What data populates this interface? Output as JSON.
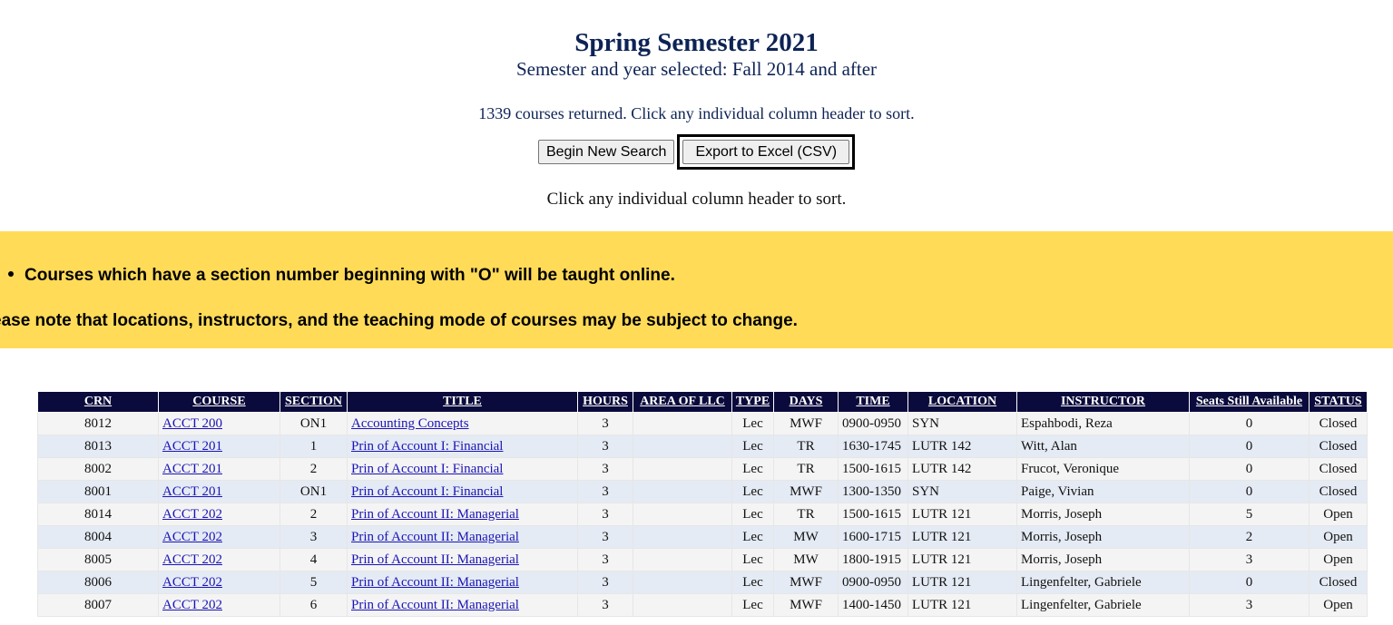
{
  "header": {
    "title": "Spring Semester 2021",
    "subtitle": "Semester and year selected: Fall 2014 and after",
    "courses_returned": "1339 courses returned. Click any individual column header to sort.",
    "sort_hint": "Click any individual column header to sort."
  },
  "buttons": {
    "new_search": "Begin New Search",
    "export": "Export to Excel (CSV)"
  },
  "notice": {
    "online": "Courses which have a section number beginning with \"O\" will be taught online.",
    "change": "ease note that locations, instructors, and the teaching mode of courses may be subject to change."
  },
  "table": {
    "headers": [
      "CRN",
      "COURSE",
      "SECTION",
      "TITLE",
      "HOURS",
      "AREA OF LLC",
      "TYPE",
      "DAYS",
      "TIME",
      "LOCATION",
      "INSTRUCTOR",
      "Seats Still Available",
      "STATUS"
    ],
    "rows": [
      {
        "crn": "8012",
        "course": "ACCT 200",
        "section": "ON1",
        "title": "Accounting Concepts",
        "hours": "3",
        "llc": "",
        "type": "Lec",
        "days": "MWF",
        "time": "0900-0950",
        "location": "SYN",
        "instructor": "Espahbodi, Reza",
        "seats": "0",
        "status": "Closed"
      },
      {
        "crn": "8013",
        "course": "ACCT 201",
        "section": "1",
        "title": "Prin of Account I: Financial",
        "hours": "3",
        "llc": "",
        "type": "Lec",
        "days": "TR",
        "time": "1630-1745",
        "location": "LUTR 142",
        "instructor": "Witt, Alan",
        "seats": "0",
        "status": "Closed"
      },
      {
        "crn": "8002",
        "course": "ACCT 201",
        "section": "2",
        "title": "Prin of Account I: Financial",
        "hours": "3",
        "llc": "",
        "type": "Lec",
        "days": "TR",
        "time": "1500-1615",
        "location": "LUTR 142",
        "instructor": "Frucot, Veronique",
        "seats": "0",
        "status": "Closed"
      },
      {
        "crn": "8001",
        "course": "ACCT 201",
        "section": "ON1",
        "title": "Prin of Account I: Financial",
        "hours": "3",
        "llc": "",
        "type": "Lec",
        "days": "MWF",
        "time": "1300-1350",
        "location": "SYN",
        "instructor": "Paige, Vivian",
        "seats": "0",
        "status": "Closed"
      },
      {
        "crn": "8014",
        "course": "ACCT 202",
        "section": "2",
        "title": "Prin of Account II: Managerial",
        "hours": "3",
        "llc": "",
        "type": "Lec",
        "days": "TR",
        "time": "1500-1615",
        "location": "LUTR 121",
        "instructor": "Morris, Joseph",
        "seats": "5",
        "status": "Open"
      },
      {
        "crn": "8004",
        "course": "ACCT 202",
        "section": "3",
        "title": "Prin of Account II: Managerial",
        "hours": "3",
        "llc": "",
        "type": "Lec",
        "days": "MW",
        "time": "1600-1715",
        "location": "LUTR 121",
        "instructor": "Morris, Joseph",
        "seats": "2",
        "status": "Open"
      },
      {
        "crn": "8005",
        "course": "ACCT 202",
        "section": "4",
        "title": "Prin of Account II: Managerial",
        "hours": "3",
        "llc": "",
        "type": "Lec",
        "days": "MW",
        "time": "1800-1915",
        "location": "LUTR 121",
        "instructor": "Morris, Joseph",
        "seats": "3",
        "status": "Open"
      },
      {
        "crn": "8006",
        "course": "ACCT 202",
        "section": "5",
        "title": "Prin of Account II: Managerial",
        "hours": "3",
        "llc": "",
        "type": "Lec",
        "days": "MWF",
        "time": "0900-0950",
        "location": "LUTR 121",
        "instructor": "Lingenfelter, Gabriele",
        "seats": "0",
        "status": "Closed"
      },
      {
        "crn": "8007",
        "course": "ACCT 202",
        "section": "6",
        "title": "Prin of Account II: Managerial",
        "hours": "3",
        "llc": "",
        "type": "Lec",
        "days": "MWF",
        "time": "1400-1450",
        "location": "LUTR 121",
        "instructor": "Lingenfelter, Gabriele",
        "seats": "3",
        "status": "Open"
      }
    ]
  }
}
